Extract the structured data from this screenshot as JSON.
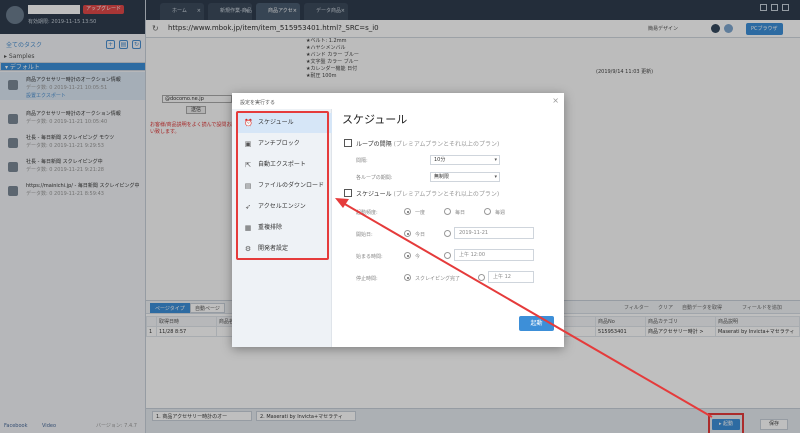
{
  "app": {
    "badge": "アップグレード",
    "subtitle": "有効期限: 2019-11-15 13:50",
    "all_tasks": "全てのタスク",
    "folders": [
      "Samples",
      "デフォルト"
    ],
    "version": "バージョン: 7.4.7",
    "facebook": "Facebook",
    "youtube": "Video"
  },
  "tasks": [
    {
      "name": "商品アクセサリー時計のオークション情報",
      "meta": "データ数: 0    2019-11-21 10:05:51",
      "sub": "設置エクスポート"
    },
    {
      "name": "商品アクセサリー時計のオークション情報",
      "meta": "データ数: 0    2019-11-21 10:05:40",
      "sub": ""
    },
    {
      "name": "社長 - 毎日新聞 スクレイピング モウツ",
      "meta": "データ数: 0    2019-11-21 9:29:53",
      "sub": ""
    },
    {
      "name": "社長 - 毎日新聞 スクレイピング中",
      "meta": "データ数: 0    2019-11-21 9:21:28",
      "sub": ""
    },
    {
      "name": "https://mainichi.jp/ - 毎日新聞 スクレイピング中",
      "meta": "データ数: 0    2019-11-21 8:59:43",
      "sub": ""
    }
  ],
  "browser": {
    "tabs": [
      "ホーム",
      "新規作業-商品",
      "商品アクセ",
      "データ商品"
    ],
    "url": "https://www.mbok.jp/item/item_515953401.html?_SRC=s_i0",
    "simple_design": "簡易デザイン",
    "pc_browser": "PCブラウザ",
    "page_col1": [
      "★ベルト: 1.2mm",
      "★ハヤシメンバル",
      "★バンド カラー ブルー",
      "★文字盤 カラー ブルー",
      "★カレンダー機能 日付",
      "★耐圧 100m"
    ],
    "page_col1_red": "お客様/商品説明をよく読んで設問お願い致します。",
    "page_email": "@docomo.ne.jp",
    "page_send": "送信",
    "page_date": "(2019/9/14 11:03 更新)"
  },
  "data_panel": {
    "tabs": [
      "ページタイプ",
      "自動ページ"
    ],
    "tools": [
      "フィルター",
      "クリア",
      "自動データを取得",
      "フィールドを追加"
    ],
    "headers": [
      "",
      "取得日時",
      "商品名",
      "商品No",
      "商品カテゴリ",
      "商品説明"
    ],
    "row": [
      "1",
      "11/28 8:57",
      "",
      "515953401",
      "商品アクセサリー時計 >",
      "Maserati by Invicta+マセラティ"
    ]
  },
  "status_bar": {
    "tabs": [
      "1. 商品アクセサリー時計のオー",
      "2. Maserati by Invicta+マセラティ"
    ],
    "run": "起動",
    "save": "保存"
  },
  "modal": {
    "title": "設定を実行する",
    "menu": [
      {
        "label": "スケジュール",
        "icon": "alarm-clock-icon"
      },
      {
        "label": "アンチブロック",
        "icon": "shield-icon"
      },
      {
        "label": "自動エクスポート",
        "icon": "export-icon"
      },
      {
        "label": "ファイルのダウンロード",
        "icon": "file-download-icon"
      },
      {
        "label": "アクセルエンジン",
        "icon": "rocket-icon"
      },
      {
        "label": "重複排除",
        "icon": "dedup-icon"
      },
      {
        "label": "開発者設定",
        "icon": "gear-icon"
      }
    ],
    "heading": "スケジュール",
    "loop_label": "ループの間隔",
    "loop_note": "(プレミアムプランとそれ以上のプラン)",
    "interval_label": "間隔:",
    "interval_value": "10分",
    "period_label": "各ループの期間:",
    "period_value": "無制限",
    "sched_label": "スケジュール",
    "sched_note": "(プレミアムプランとそれ以上のプラン)",
    "freq_label": "起動頻度:",
    "freq_options": [
      "一度",
      "毎日",
      "毎週"
    ],
    "start_date_label": "開始日:",
    "today": "今日",
    "start_date_value": "2019-11-21",
    "start_time_label": "始まる時間:",
    "now": "今",
    "start_time_value": "上午 12:00",
    "stop_time_label": "停止時間:",
    "stop_option": "スクレイピング完了",
    "stop_time_value": "上午 12",
    "start_button": "起動"
  },
  "colors": {
    "accent": "#3d8fd8",
    "highlight": "#e53b3b",
    "dark": "#2f3d4e"
  }
}
